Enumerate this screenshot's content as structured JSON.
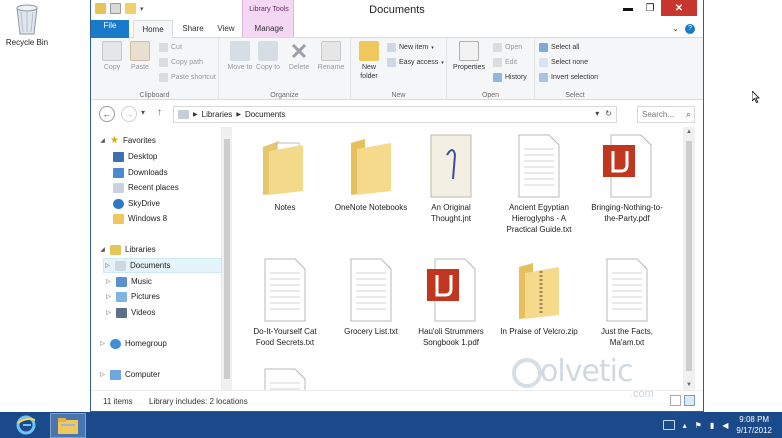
{
  "desktop": {
    "recycle_bin_label": "Recycle Bin"
  },
  "window": {
    "title": "Documents",
    "library_tools_label": "Library Tools",
    "controls": {
      "minimize": "▬",
      "maximize": "❐",
      "close": "✕"
    }
  },
  "tabs": [
    {
      "label": "File"
    },
    {
      "label": "Home"
    },
    {
      "label": "Share"
    },
    {
      "label": "View"
    },
    {
      "label": "Manage"
    }
  ],
  "ribbon": {
    "clipboard": {
      "name": "Clipboard",
      "copy": "Copy",
      "paste": "Paste",
      "cut": "Cut",
      "copy_path": "Copy path",
      "paste_shortcut": "Paste shortcut"
    },
    "organize": {
      "name": "Organize",
      "move_to": "Move to",
      "copy_to": "Copy to",
      "delete": "Delete",
      "rename": "Rename"
    },
    "new": {
      "name": "New",
      "new_folder": "New folder",
      "new_item": "New item",
      "easy_access": "Easy access"
    },
    "open": {
      "name": "Open",
      "properties": "Properties",
      "open": "Open",
      "edit": "Edit",
      "history": "History"
    },
    "select": {
      "name": "Select",
      "select_all": "Select all",
      "select_none": "Select none",
      "invert_selection": "Invert selection"
    }
  },
  "address": {
    "crumbs": [
      "Libraries",
      "Documents"
    ],
    "search_placeholder": "Search..."
  },
  "nav_tree": {
    "favorites": "Favorites",
    "desktop": "Desktop",
    "downloads": "Downloads",
    "recent_places": "Recent places",
    "skydrive": "SkyDrive",
    "windows8": "Windows 8",
    "libraries": "Libraries",
    "documents": "Documents",
    "music": "Music",
    "pictures": "Pictures",
    "videos": "Videos",
    "homegroup": "Homegroup",
    "computer": "Computer"
  },
  "files": [
    {
      "name": "Notes",
      "kind": "folder-docs"
    },
    {
      "name": "OneNote Notebooks",
      "kind": "folder"
    },
    {
      "name": "An Original Thought.jnt",
      "kind": "journal"
    },
    {
      "name": "Ancient Egyptian Hieroglyphs - A Practical Guide.txt",
      "kind": "text"
    },
    {
      "name": "Bringing-Nothing-to-the-Party.pdf",
      "kind": "pdf"
    },
    {
      "name": "Do-It-Yourself Cat Food Secrets.txt",
      "kind": "text"
    },
    {
      "name": "Grocery List.txt",
      "kind": "text"
    },
    {
      "name": "Hau'oli Strummers Songbook 1.pdf",
      "kind": "pdf"
    },
    {
      "name": "In Praise of Velcro.zip",
      "kind": "zip"
    },
    {
      "name": "Just the Facts, Ma'am.txt",
      "kind": "text"
    },
    {
      "name": "",
      "kind": "text"
    }
  ],
  "status": {
    "count": "11 items",
    "library_info": "Library includes: 2 locations"
  },
  "watermark": {
    "text": "olvetic",
    "sub": ".com"
  },
  "taskbar": {
    "time": "9:08 PM",
    "date": "9/17/2012"
  }
}
